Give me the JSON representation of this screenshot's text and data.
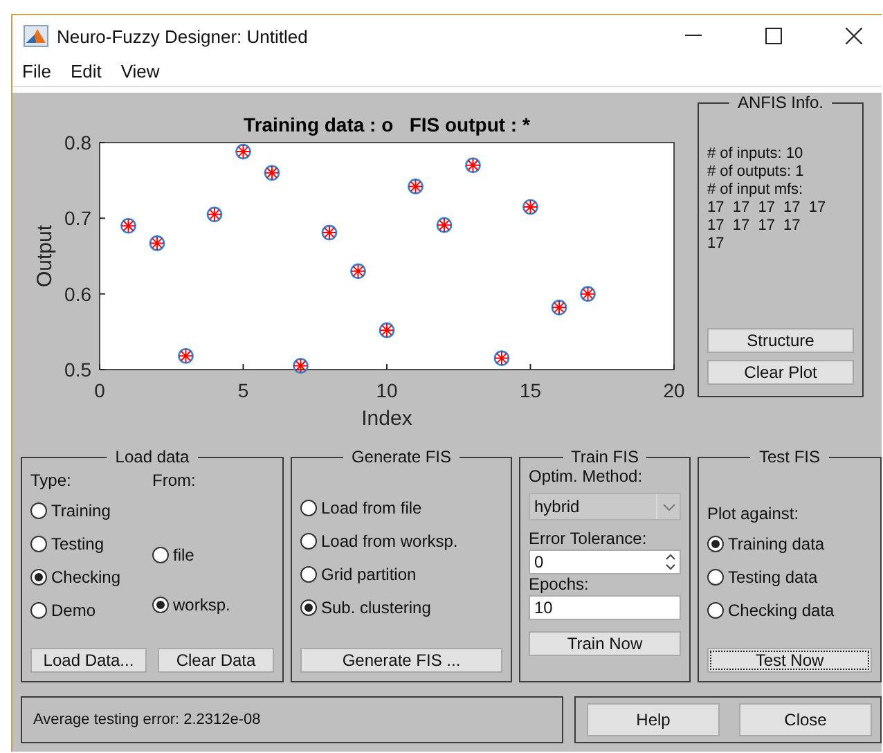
{
  "window": {
    "title": "Neuro-Fuzzy Designer: Untitled"
  },
  "menu": [
    "File",
    "Edit",
    "View"
  ],
  "plot": {
    "chart_data": {
      "type": "scatter",
      "title": "Training data : o   FIS output : *",
      "xlabel": "Index",
      "ylabel": "Output",
      "xlim": [
        0,
        20
      ],
      "ylim": [
        0.5,
        0.8
      ],
      "xticks": [
        0,
        5,
        10,
        15,
        20
      ],
      "yticks": [
        0.5,
        0.6,
        0.7,
        0.8
      ],
      "x": [
        1,
        2,
        3,
        4,
        5,
        6,
        7,
        8,
        9,
        10,
        11,
        12,
        13,
        14,
        15,
        16,
        17
      ],
      "series": [
        {
          "color": "#2e86d6",
          "values": [
            0.69,
            0.667,
            0.518,
            0.705,
            0.788,
            0.76,
            0.505,
            0.681,
            0.63,
            0.552,
            0.742,
            0.691,
            0.77,
            0.515,
            0.715,
            0.582,
            0.6
          ]
        },
        {
          "color": "#ff0000",
          "values": [
            0.69,
            0.667,
            0.518,
            0.705,
            0.788,
            0.76,
            0.505,
            0.681,
            0.63,
            0.552,
            0.742,
            0.691,
            0.77,
            0.515,
            0.715,
            0.582,
            0.6
          ]
        }
      ]
    }
  },
  "anfis_info": {
    "title": "ANFIS Info.",
    "lines": [
      "# of inputs: 10",
      "# of outputs: 1",
      "# of input mfs:",
      "17  17  17  17  17",
      "17  17  17  17",
      "17"
    ],
    "buttons": [
      "Structure",
      "Clear Plot"
    ]
  },
  "load_data": {
    "title": "Load data",
    "type_label": "Type:",
    "from_label": "From:",
    "types": [
      {
        "label": "Training",
        "selected": false
      },
      {
        "label": "Testing",
        "selected": false
      },
      {
        "label": "Checking",
        "selected": true
      },
      {
        "label": "Demo",
        "selected": false
      }
    ],
    "sources": [
      {
        "label": "file",
        "selected": false
      },
      {
        "label": "worksp.",
        "selected": true
      }
    ],
    "buttons": [
      "Load Data...",
      "Clear Data"
    ]
  },
  "generate_fis": {
    "title": "Generate FIS",
    "options": [
      {
        "label": "Load from file",
        "selected": false
      },
      {
        "label": "Load from worksp.",
        "selected": false
      },
      {
        "label": "Grid partition",
        "selected": false
      },
      {
        "label": "Sub. clustering",
        "selected": true
      }
    ],
    "button": "Generate FIS ..."
  },
  "train_fis": {
    "title": "Train FIS",
    "method_label": "Optim. Method:",
    "method": "hybrid",
    "tolerance_label": "Error Tolerance:",
    "tolerance": "0",
    "epochs_label": "Epochs:",
    "epochs": "10",
    "button": "Train Now"
  },
  "test_fis": {
    "title": "Test FIS",
    "plot_label": "Plot against:",
    "options": [
      {
        "label": "Training data",
        "selected": true
      },
      {
        "label": "Testing data",
        "selected": false
      },
      {
        "label": "Checking data",
        "selected": false
      }
    ],
    "button": {
      "label": "Test Now",
      "focused": true
    }
  },
  "status": "Average testing error: 2.2312e-08",
  "buttons": [
    "Help",
    "Close"
  ]
}
